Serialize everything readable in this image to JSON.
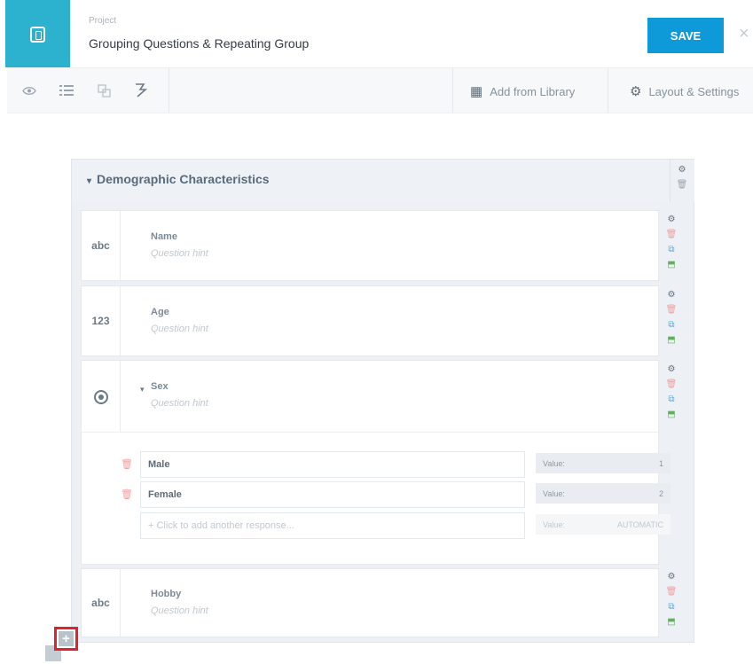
{
  "header": {
    "project_label": "Project",
    "project_title": "Grouping Questions & Repeating Group",
    "save_label": "SAVE",
    "close_icon": "×"
  },
  "toolbar": {
    "tools": [
      "eye-icon",
      "list-icon",
      "copy-icon",
      "logic-icon"
    ],
    "add_from_library": "Add from Library",
    "layout_settings": "Layout & Settings"
  },
  "group": {
    "title": "Demographic Characteristics",
    "caret": "▾"
  },
  "questions": [
    {
      "type_label": "abc",
      "label": "Name",
      "hint": "Question hint"
    },
    {
      "type_label": "123",
      "label": "Age",
      "hint": "Question hint"
    },
    {
      "type_label": "radio-icon",
      "label": "Sex",
      "hint": "Question hint"
    },
    {
      "type_label": "abc",
      "label": "Hobby",
      "hint": "Question hint"
    }
  ],
  "responses": [
    {
      "label": "Male",
      "value_label": "Value:",
      "value": "1"
    },
    {
      "label": "Female",
      "value_label": "Value:",
      "value": "2"
    }
  ],
  "add_response": {
    "placeholder": "+ Click to add another response...",
    "value_label": "Value:",
    "value": "AUTOMATIC"
  },
  "colors": {
    "brand": "#2cb2ce",
    "save": "#0e9ad8",
    "highlight": "#e0222e"
  }
}
